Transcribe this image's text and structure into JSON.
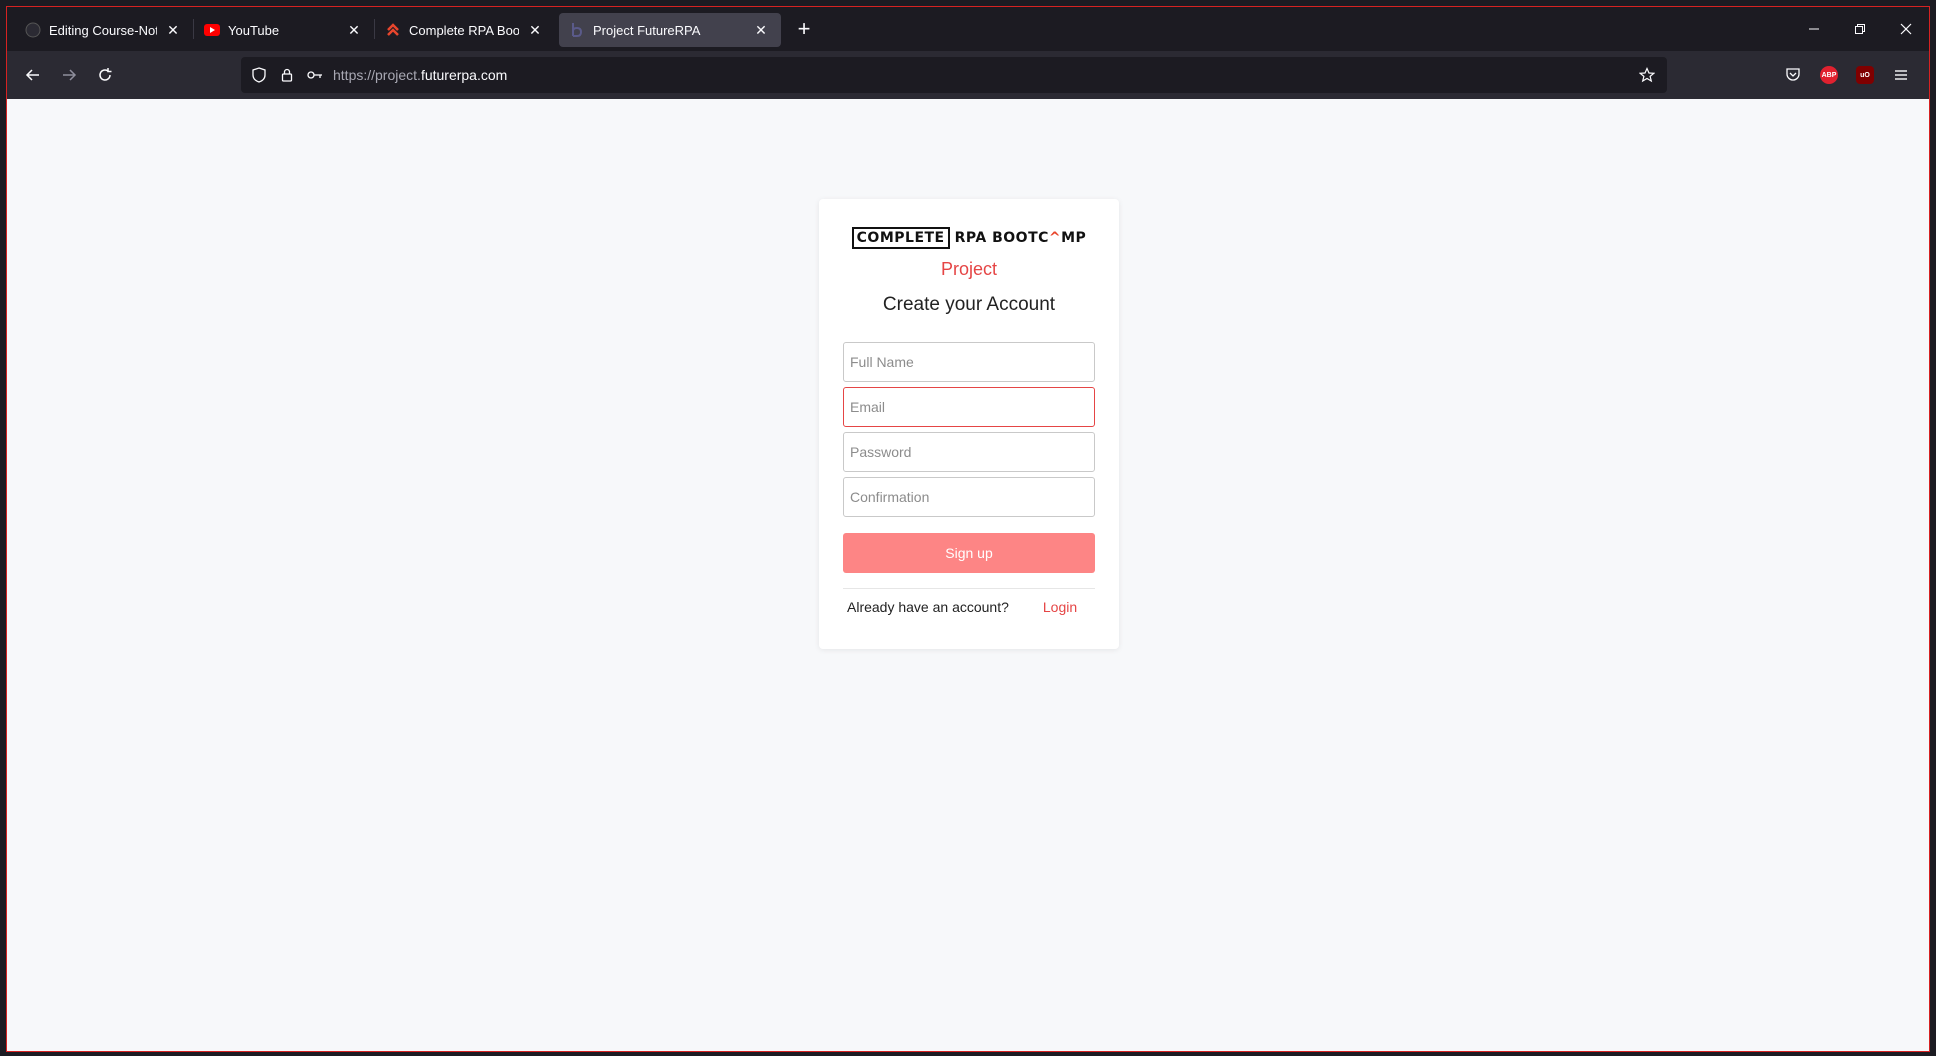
{
  "browser": {
    "tabs": [
      {
        "title": "Editing Course-Notes/E-Mail Int",
        "favicon": "github-icon",
        "active": false
      },
      {
        "title": "YouTube",
        "favicon": "youtube-icon",
        "active": false
      },
      {
        "title": "Complete RPA Bootcamp: Mem",
        "favicon": "rpa-bootcamp-icon",
        "active": false
      },
      {
        "title": "Project FutureRPA",
        "favicon": "futurerpa-icon",
        "active": true
      }
    ],
    "url_prefix": "https://project.",
    "url_domain": "futurerpa.com"
  },
  "page": {
    "logo": {
      "boxed": "COMPLETE",
      "part1": "RPA BOOTC",
      "caret": "^",
      "part2": "MP"
    },
    "project_label": "Project",
    "heading": "Create your Account",
    "fields": {
      "full_name_placeholder": "Full Name",
      "email_placeholder": "Email",
      "password_placeholder": "Password",
      "confirmation_placeholder": "Confirmation"
    },
    "signup_label": "Sign up",
    "already_text": "Already have an account?",
    "login_label": "Login"
  },
  "colors": {
    "accent": "#e54545",
    "button": "#fd8585",
    "page_bg": "#f7f8fa"
  }
}
